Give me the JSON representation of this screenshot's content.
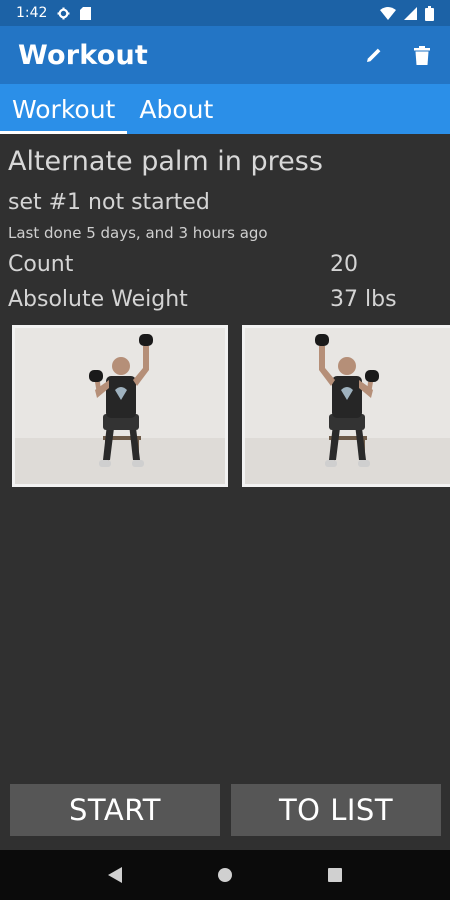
{
  "status_bar": {
    "time": "1:42",
    "icons": [
      "settings-icon",
      "sd-card-icon",
      "wifi-icon",
      "signal-icon",
      "battery-icon"
    ]
  },
  "app_bar": {
    "title": "Workout",
    "actions": [
      "edit-icon",
      "delete-icon"
    ]
  },
  "tabs": [
    {
      "label": "Workout",
      "active": true
    },
    {
      "label": "About",
      "active": false
    }
  ],
  "exercise": {
    "name": "Alternate palm in press",
    "set_status": "set #1 not started",
    "last_done": "Last done 5 days, and 3 hours ago",
    "stats": [
      {
        "label": "Count",
        "value": "20"
      },
      {
        "label": "Absolute Weight",
        "value": "37 lbs"
      }
    ],
    "images": [
      "exercise-photo-left-arm-up",
      "exercise-photo-right-arm-up"
    ]
  },
  "buttons": {
    "start": "START",
    "to_list": "TO LIST"
  },
  "nav_bar": {
    "icons": [
      "back-icon",
      "home-icon",
      "recents-icon"
    ]
  },
  "colors": {
    "status_bar": "#1c62a6",
    "app_bar": "#2375c5",
    "tab_bar": "#2b8fe8",
    "background": "#303030",
    "button": "#565656"
  }
}
